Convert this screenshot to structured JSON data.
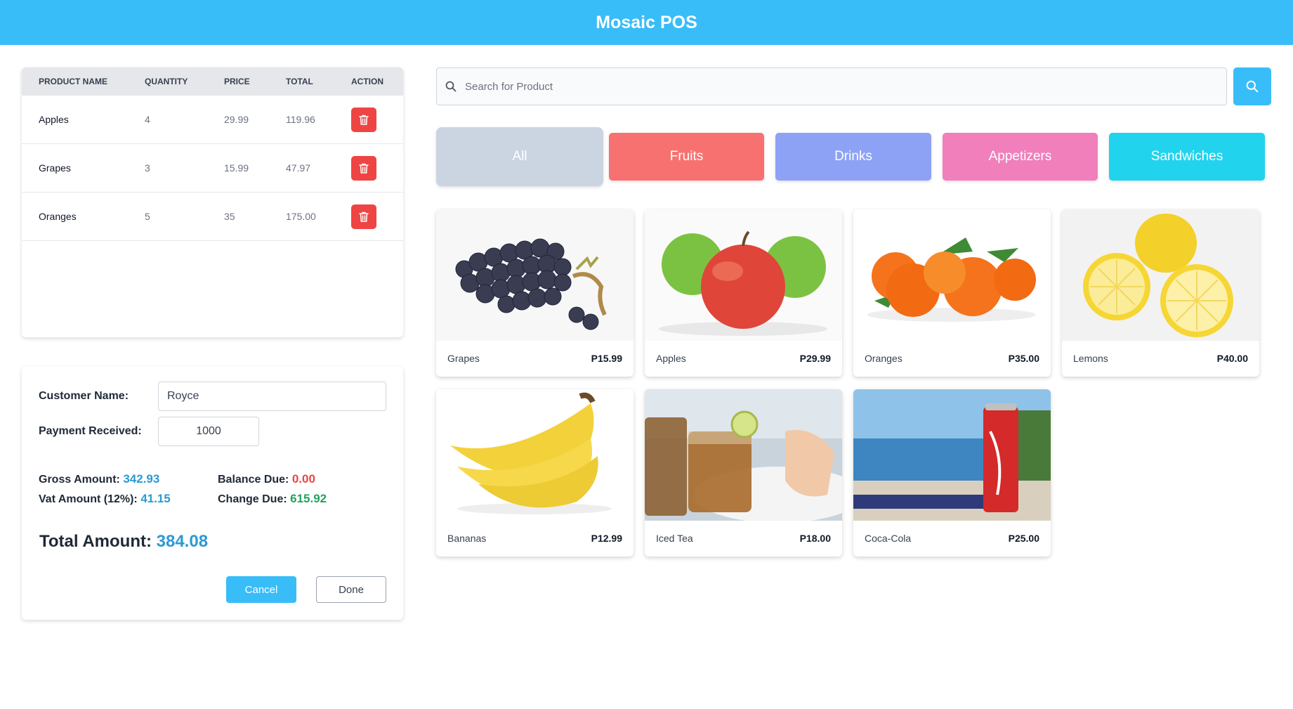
{
  "header": {
    "title": "Mosaic POS"
  },
  "cart": {
    "columns": [
      "PRODUCT NAME",
      "QUANTITY",
      "PRICE",
      "TOTAL",
      "ACTION"
    ],
    "rows": [
      {
        "name": "Apples",
        "quantity": "4",
        "price": "29.99",
        "total": "119.96"
      },
      {
        "name": "Grapes",
        "quantity": "3",
        "price": "15.99",
        "total": "47.97"
      },
      {
        "name": "Oranges",
        "quantity": "5",
        "price": "35",
        "total": "175.00"
      }
    ],
    "delete_icon": "trash-icon"
  },
  "payment": {
    "customer_label": "Customer Name:",
    "customer_value": "Royce",
    "received_label": "Payment Received:",
    "received_value": "1000",
    "gross_label": "Gross Amount:",
    "gross_value": "342.93",
    "vat_label": "Vat Amount (12%):",
    "vat_value": "41.15",
    "balance_label": "Balance Due:",
    "balance_value": "0.00",
    "change_label": "Change Due:",
    "change_value": "615.92",
    "total_label": "Total Amount:",
    "total_value": "384.08",
    "cancel_label": "Cancel",
    "done_label": "Done"
  },
  "search": {
    "placeholder": "Search for Product",
    "icon": "search-icon"
  },
  "categories": [
    {
      "label": "All",
      "color": "#cbd5e1",
      "selected": true
    },
    {
      "label": "Fruits",
      "color": "#f87171"
    },
    {
      "label": "Drinks",
      "color": "#8ea2f5"
    },
    {
      "label": "Appetizers",
      "color": "#f07fbc"
    },
    {
      "label": "Sandwiches",
      "color": "#22d3ee"
    }
  ],
  "products": [
    {
      "name": "Grapes",
      "price": "P15.99"
    },
    {
      "name": "Apples",
      "price": "P29.99"
    },
    {
      "name": "Oranges",
      "price": "P35.00"
    },
    {
      "name": "Lemons",
      "price": "P40.00"
    },
    {
      "name": "Bananas",
      "price": "P12.99"
    },
    {
      "name": "Iced Tea",
      "price": "P18.00"
    },
    {
      "name": "Coca-Cola",
      "price": "P25.00"
    }
  ],
  "colors": {
    "accent": "#38bdf8",
    "danger": "#ef4444",
    "positive": "#22a25f",
    "value_blue": "#2b9ad4"
  }
}
